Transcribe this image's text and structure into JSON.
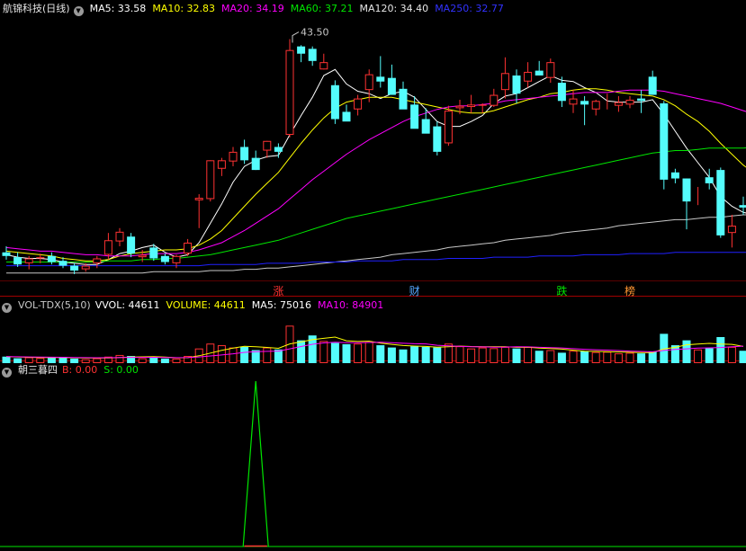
{
  "price_header": {
    "title": "航锦科技(日线)",
    "ma5": "MA5: 33.58",
    "ma10": "MA10: 32.83",
    "ma20": "MA20: 34.19",
    "ma60": "MA60: 37.21",
    "ma120": "MA120: 34.40",
    "ma250": "MA250: 32.77"
  },
  "vol_header": {
    "title": "VOL-TDX(5,10)",
    "vvol": "VVOL: 44611",
    "volume": "VOLUME: 44611",
    "ma5": "MA5: 75016",
    "ma10": "MA10: 84901"
  },
  "ind_header": {
    "title": "朝三暮四",
    "b": "B: 0.00",
    "s": "S: 0.00"
  },
  "colors": {
    "up": "#ff3232",
    "down": "#54fcfc",
    "ma5": "#ffffff",
    "ma10": "#ffff00",
    "ma20": "#ff00ff",
    "ma60": "#00e600",
    "ma120": "#c8c8c8",
    "ma250": "#2020ff",
    "signal": "#00e600"
  },
  "chart_data": [
    {
      "type": "candlestick",
      "title": "航锦科技(日线)",
      "max_label": "43.50",
      "ylim": [
        24.6,
        45.6
      ],
      "candles": [
        [
          26.4,
          26.9,
          25.8,
          26.1
        ],
        [
          26.0,
          26.4,
          25.2,
          25.4
        ],
        [
          25.5,
          26.1,
          25.0,
          25.9
        ],
        [
          25.9,
          26.3,
          25.5,
          26.0
        ],
        [
          26.1,
          26.4,
          25.4,
          25.6
        ],
        [
          25.7,
          26.0,
          25.1,
          25.3
        ],
        [
          25.3,
          25.5,
          24.6,
          24.9
        ],
        [
          25.0,
          25.5,
          24.8,
          25.3
        ],
        [
          25.5,
          26.1,
          25.1,
          25.9
        ],
        [
          26.2,
          28.0,
          25.8,
          27.4
        ],
        [
          27.3,
          28.4,
          26.9,
          28.1
        ],
        [
          27.7,
          28.0,
          26.0,
          26.3
        ],
        [
          26.0,
          26.6,
          25.6,
          26.2
        ],
        [
          26.8,
          27.1,
          25.7,
          25.9
        ],
        [
          26.1,
          26.3,
          25.4,
          25.6
        ],
        [
          25.5,
          26.2,
          25.1,
          26.1
        ],
        [
          26.3,
          27.5,
          26.1,
          27.2
        ],
        [
          30.7,
          31.2,
          28.4,
          30.9
        ],
        [
          30.8,
          34.0,
          30.6,
          34.0
        ],
        [
          33.3,
          34.2,
          32.7,
          34.0
        ],
        [
          33.9,
          35.1,
          33.5,
          34.7
        ],
        [
          35.1,
          35.7,
          33.7,
          34.0
        ],
        [
          34.2,
          34.8,
          33.2,
          33.2
        ],
        [
          34.8,
          35.6,
          34.2,
          35.6
        ],
        [
          35.1,
          35.4,
          34.2,
          34.7
        ],
        [
          36.1,
          44.0,
          35.9,
          43.1
        ],
        [
          43.4,
          43.5,
          42.1,
          42.8
        ],
        [
          43.2,
          43.4,
          41.8,
          42.2
        ],
        [
          41.5,
          42.8,
          41.5,
          42.1
        ],
        [
          40.2,
          40.6,
          37.0,
          37.4
        ],
        [
          38.0,
          38.6,
          37.3,
          37.2
        ],
        [
          38.2,
          39.4,
          37.7,
          39.1
        ],
        [
          39.8,
          41.5,
          38.8,
          41.1
        ],
        [
          40.9,
          42.6,
          40.0,
          40.5
        ],
        [
          40.8,
          41.9,
          39.5,
          39.4
        ],
        [
          39.9,
          40.5,
          38.6,
          38.2
        ],
        [
          38.6,
          39.3,
          37.4,
          36.6
        ],
        [
          37.4,
          38.3,
          36.4,
          36.2
        ],
        [
          36.8,
          37.2,
          34.4,
          34.7
        ],
        [
          35.4,
          38.5,
          35.2,
          38.1
        ],
        [
          38.3,
          39.0,
          37.8,
          38.5
        ],
        [
          38.4,
          39.4,
          37.9,
          38.6
        ],
        [
          38.5,
          38.7,
          37.9,
          38.6
        ],
        [
          38.5,
          39.9,
          38.4,
          39.4
        ],
        [
          39.8,
          42.5,
          39.1,
          41.2
        ],
        [
          41.0,
          41.5,
          38.7,
          39.5
        ],
        [
          40.5,
          42.1,
          40.0,
          41.3
        ],
        [
          41.4,
          42.2,
          41.0,
          41.0
        ],
        [
          40.8,
          42.4,
          40.4,
          42.1
        ],
        [
          40.4,
          40.9,
          38.4,
          38.9
        ],
        [
          38.6,
          39.8,
          37.9,
          39.1
        ],
        [
          38.9,
          39.3,
          36.9,
          38.6
        ],
        [
          38.2,
          39.0,
          37.7,
          38.9
        ],
        [
          38.8,
          39.5,
          38.2,
          38.8
        ],
        [
          38.5,
          39.3,
          38.0,
          38.8
        ],
        [
          38.6,
          39.3,
          38.3,
          39.0
        ],
        [
          39.1,
          39.8,
          37.9,
          38.9
        ],
        [
          40.9,
          41.4,
          39.6,
          39.4
        ],
        [
          38.7,
          38.9,
          31.6,
          32.4
        ],
        [
          33.0,
          33.3,
          32.1,
          32.5
        ],
        [
          32.5,
          32.5,
          28.3,
          30.6
        ],
        [
          31.6,
          31.8,
          30.3,
          31.6
        ],
        [
          32.6,
          33.3,
          31.6,
          32.1
        ],
        [
          33.2,
          33.4,
          27.6,
          27.8
        ],
        [
          28.0,
          29.5,
          26.8,
          28.6
        ],
        [
          30.3,
          31.0,
          29.5,
          30.1
        ],
        [
          30.0,
          30.9,
          29.3,
          30.5
        ]
      ],
      "ma": {
        "ma5": [
          26.2,
          26.0,
          25.9,
          25.9,
          25.8,
          25.6,
          25.5,
          25.4,
          25.4,
          25.8,
          26.3,
          26.5,
          26.8,
          27.0,
          26.4,
          26.0,
          26.2,
          27.2,
          28.8,
          30.4,
          32.2,
          33.5,
          34.0,
          34.3,
          34.4,
          36.1,
          37.7,
          39.2,
          41.0,
          41.5,
          40.3,
          39.7,
          39.5,
          39.1,
          39.5,
          39.7,
          39.2,
          38.2,
          37.2,
          36.8,
          36.8,
          37.2,
          37.7,
          38.7,
          39.3,
          39.5,
          40.0,
          40.5,
          41.0,
          40.6,
          40.5,
          40.0,
          39.6,
          38.9,
          38.8,
          38.8,
          38.8,
          39.0,
          37.8,
          36.4,
          35.0,
          33.8,
          32.6,
          31.0,
          30.2,
          29.7,
          29.5
        ],
        "ma10": [
          26.5,
          26.4,
          26.3,
          26.2,
          26.1,
          25.9,
          25.8,
          25.7,
          25.7,
          25.8,
          26.1,
          26.3,
          26.4,
          26.5,
          26.6,
          26.6,
          26.7,
          27.0,
          27.5,
          28.2,
          29.2,
          30.2,
          31.2,
          32.1,
          33.0,
          34.2,
          35.4,
          36.5,
          37.5,
          38.3,
          38.8,
          39.0,
          39.2,
          39.2,
          39.2,
          39.0,
          38.8,
          38.6,
          38.4,
          38.2,
          38.0,
          37.9,
          37.9,
          38.1,
          38.4,
          38.7,
          39.0,
          39.2,
          39.5,
          39.6,
          39.8,
          39.9,
          39.9,
          39.8,
          39.6,
          39.5,
          39.4,
          39.3,
          39.0,
          38.5,
          37.8,
          37.2,
          36.4,
          35.4,
          34.5,
          33.6,
          32.9
        ],
        "ma20": [
          26.8,
          26.7,
          26.6,
          26.5,
          26.5,
          26.4,
          26.3,
          26.2,
          26.2,
          26.1,
          26.1,
          26.1,
          26.2,
          26.3,
          26.3,
          26.3,
          26.4,
          26.6,
          26.9,
          27.2,
          27.7,
          28.2,
          28.8,
          29.4,
          30.0,
          30.8,
          31.6,
          32.4,
          33.1,
          33.8,
          34.5,
          35.1,
          35.7,
          36.2,
          36.7,
          37.2,
          37.6,
          37.9,
          38.2,
          38.4,
          38.5,
          38.5,
          38.6,
          38.7,
          38.9,
          39.0,
          39.1,
          39.2,
          39.3,
          39.4,
          39.5,
          39.6,
          39.6,
          39.6,
          39.7,
          39.8,
          39.8,
          39.8,
          39.7,
          39.5,
          39.3,
          39.1,
          38.9,
          38.7,
          38.4,
          38.1,
          37.8
        ],
        "ma60": [
          25.6,
          25.6,
          25.6,
          25.6,
          25.6,
          25.6,
          25.6,
          25.6,
          25.6,
          25.7,
          25.7,
          25.7,
          25.8,
          25.8,
          25.9,
          25.9,
          26.0,
          26.1,
          26.2,
          26.4,
          26.6,
          26.8,
          27.0,
          27.2,
          27.4,
          27.7,
          28.0,
          28.3,
          28.6,
          28.9,
          29.2,
          29.4,
          29.6,
          29.8,
          30.0,
          30.2,
          30.4,
          30.6,
          30.8,
          31.0,
          31.2,
          31.4,
          31.6,
          31.8,
          32.0,
          32.2,
          32.4,
          32.6,
          32.8,
          33.0,
          33.2,
          33.4,
          33.6,
          33.8,
          34.0,
          34.2,
          34.4,
          34.6,
          34.7,
          34.8,
          34.8,
          34.9,
          35.0,
          35.0,
          35.0,
          35.0,
          35.1
        ],
        "ma120": [
          24.7,
          24.7,
          24.7,
          24.7,
          24.7,
          24.7,
          24.7,
          24.7,
          24.7,
          24.7,
          24.7,
          24.7,
          24.7,
          24.8,
          24.8,
          24.8,
          24.8,
          24.8,
          24.9,
          24.9,
          24.9,
          25.0,
          25.0,
          25.1,
          25.1,
          25.2,
          25.3,
          25.4,
          25.5,
          25.6,
          25.7,
          25.8,
          25.9,
          26.0,
          26.2,
          26.3,
          26.4,
          26.5,
          26.6,
          26.8,
          26.9,
          27.0,
          27.1,
          27.2,
          27.4,
          27.5,
          27.6,
          27.7,
          27.8,
          28.0,
          28.1,
          28.2,
          28.3,
          28.4,
          28.6,
          28.7,
          28.8,
          28.9,
          29.0,
          29.1,
          29.1,
          29.2,
          29.3,
          29.3,
          29.4,
          29.5,
          29.5
        ],
        "ma250": [
          25.3,
          25.3,
          25.3,
          25.3,
          25.3,
          25.3,
          25.3,
          25.3,
          25.3,
          25.3,
          25.3,
          25.3,
          25.3,
          25.3,
          25.3,
          25.3,
          25.3,
          25.3,
          25.4,
          25.4,
          25.4,
          25.4,
          25.4,
          25.5,
          25.5,
          25.5,
          25.5,
          25.6,
          25.6,
          25.6,
          25.6,
          25.7,
          25.7,
          25.7,
          25.7,
          25.8,
          25.8,
          25.8,
          25.8,
          25.9,
          25.9,
          25.9,
          25.9,
          26.0,
          26.0,
          26.0,
          26.0,
          26.1,
          26.1,
          26.1,
          26.1,
          26.2,
          26.2,
          26.2,
          26.2,
          26.3,
          26.3,
          26.3,
          26.3,
          26.4,
          26.4,
          26.4,
          26.4,
          26.4,
          26.4,
          26.4,
          26.4
        ]
      },
      "markers": [
        {
          "index": 24,
          "text": "涨",
          "color": "#ff3232"
        },
        {
          "index": 36,
          "text": "财",
          "color": "#54a8ff"
        },
        {
          "index": 49,
          "text": "跌",
          "color": "#00e600"
        },
        {
          "index": 55,
          "text": "榜",
          "color": "#ff9632"
        }
      ]
    },
    {
      "type": "bar",
      "title": "VOL-TDX(5,10)",
      "ylim": [
        0,
        160000
      ],
      "values": [
        20000,
        15000,
        18000,
        16000,
        18000,
        19000,
        14000,
        12000,
        15000,
        20000,
        25000,
        22000,
        15000,
        18000,
        14000,
        14000,
        22000,
        45000,
        60000,
        55000,
        48000,
        50000,
        40000,
        48000,
        42000,
        115000,
        70000,
        85000,
        68000,
        62000,
        58000,
        60000,
        65000,
        55000,
        48000,
        42000,
        52000,
        50000,
        48000,
        60000,
        52000,
        45000,
        48000,
        46000,
        50000,
        45000,
        50000,
        38000,
        40000,
        32000,
        38000,
        36000,
        34000,
        35000,
        30000,
        32000,
        30000,
        36000,
        90000,
        55000,
        70000,
        42000,
        46000,
        80000,
        50000,
        38000,
        44611
      ],
      "ma5": [
        20000,
        19000,
        18000,
        17500,
        17400,
        17000,
        16600,
        15600,
        15600,
        16000,
        17200,
        18800,
        19400,
        20000,
        18800,
        16600,
        16600,
        22600,
        31000,
        39200,
        46000,
        51600,
        50600,
        48200,
        45600,
        59000,
        65000,
        72000,
        76000,
        80000,
        68600,
        66600,
        67600,
        61600,
        57600,
        54000,
        52400,
        51400,
        49000,
        50400,
        52400,
        51000,
        50600,
        50200,
        50200,
        48600,
        48800,
        46200,
        44600,
        43000,
        39600,
        36800,
        36000,
        35000,
        34600,
        33400,
        32400,
        32600,
        43600,
        48600,
        56200,
        58600,
        60600,
        58600,
        57600,
        51200,
        51800
      ],
      "ma10": [
        20000,
        19500,
        19000,
        18500,
        18200,
        17800,
        17300,
        16800,
        16500,
        16700,
        17100,
        17700,
        17700,
        17800,
        17200,
        16800,
        17200,
        19000,
        22000,
        25000,
        28800,
        33000,
        35000,
        36000,
        37000,
        44000,
        51000,
        58000,
        62000,
        64000,
        63000,
        63000,
        63500,
        64000,
        63000,
        61000,
        59500,
        59000,
        55000,
        53000,
        51500,
        50500,
        50000,
        49000,
        49500,
        50500,
        50000,
        48500,
        47500,
        46500,
        44500,
        42500,
        41000,
        40000,
        38500,
        37000,
        35800,
        34800,
        39000,
        41800,
        44000,
        46000,
        47000,
        48000,
        50500,
        52000,
        84901
      ],
      "labels": [
        "VVOL: 44611",
        "VOLUME: 44611",
        "MA5: 75016",
        "MA10: 84901"
      ]
    },
    {
      "type": "line",
      "title": "朝三暮四",
      "ylim": [
        0,
        1
      ],
      "series": [
        {
          "name": "B",
          "color": "#ff3232",
          "values": [
            0,
            0,
            0,
            0,
            0,
            0,
            0,
            0,
            0,
            0,
            0,
            0,
            0,
            0,
            0,
            0,
            0,
            0,
            0,
            0,
            0,
            0,
            0,
            0,
            0,
            0,
            0,
            0,
            0,
            0,
            0,
            0,
            0,
            0,
            0,
            0,
            0,
            0,
            0,
            0,
            0,
            0,
            0,
            0,
            0,
            0,
            0,
            0,
            0,
            0,
            0,
            0,
            0,
            0,
            0,
            0,
            0,
            0,
            0,
            0,
            0,
            0,
            0,
            0,
            0,
            0,
            0
          ]
        },
        {
          "name": "S",
          "color": "#00e600",
          "values": [
            0,
            0,
            0,
            0,
            0,
            0,
            0,
            0,
            0,
            0,
            0,
            0,
            0,
            0,
            0,
            0,
            0,
            0,
            0,
            0,
            0,
            0,
            0,
            0,
            0,
            0,
            0,
            0,
            0,
            0,
            0,
            0,
            0,
            0,
            0,
            0,
            0,
            0,
            0,
            0,
            0,
            0,
            0,
            0,
            0,
            0,
            0,
            0,
            0,
            0,
            0,
            0,
            0,
            0,
            0,
            0,
            0,
            0,
            0,
            0,
            0,
            0,
            0,
            0,
            0,
            0,
            0
          ]
        }
      ],
      "spike": {
        "index": 22,
        "value": 1
      }
    }
  ]
}
